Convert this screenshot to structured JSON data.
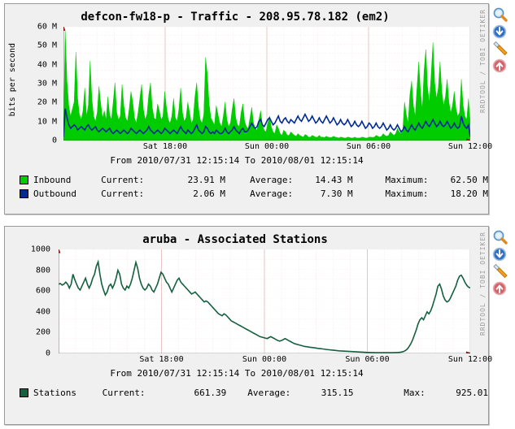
{
  "charts": [
    {
      "title": "defcon-fw18-p - Traffic - 208.95.78.182 (em2)",
      "ylabel": "bits per second",
      "watermark": "RRDTOOL / TOBI OETIKER",
      "range": "From 2010/07/31 12:15:14 To 2010/08/01 12:15:14",
      "yticks": [
        "60 M",
        "50 M",
        "40 M",
        "30 M",
        "20 M",
        "10 M",
        "0"
      ],
      "xticks": [
        "Sat 18:00",
        "Sun 00:00",
        "Sun 06:00",
        "Sun 12:00"
      ],
      "legend": [
        {
          "color": "#00cc00",
          "name": "Inbound",
          "k1": "Current:",
          "v1": "23.91 M",
          "k2": "Average:",
          "v2": "14.43 M",
          "k3": "Maximum:",
          "v3": "62.50 M"
        },
        {
          "color": "#002a97",
          "name": "Outbound",
          "k1": "Current:",
          "v1": "2.06 M",
          "k2": "Average:",
          "v2": "7.30 M",
          "k3": "Maximum:",
          "v3": "18.20 M"
        }
      ]
    },
    {
      "title": "aruba - Associated Stations",
      "ylabel": "",
      "watermark": "RRDTOOL / TOBI OETIKER",
      "range": "From 2010/07/31 12:15:14 To 2010/08/01 12:15:14",
      "yticks": [
        "1000",
        "800",
        "600",
        "400",
        "200",
        "0"
      ],
      "xticks": [
        "Sat 18:00",
        "Sun 00:00",
        "Sun 06:00",
        "Sun 12:00"
      ],
      "legend": [
        {
          "color": "#14603f",
          "name": "Stations",
          "k1": "Current:",
          "v1": "661.39",
          "k2": "Average:",
          "v2": "315.15",
          "k3": "Max:",
          "v3": "925.01"
        }
      ]
    }
  ],
  "icons": [
    {
      "name": "zoom-in-icon",
      "title": "Zoom"
    },
    {
      "name": "zoom-out-icon",
      "title": "Shrink"
    },
    {
      "name": "settings-wrench-icon",
      "title": "Properties"
    },
    {
      "name": "refresh-up-icon",
      "title": "Grow"
    }
  ],
  "chart_data": [
    {
      "type": "area",
      "title": "defcon-fw18-p - Traffic - 208.95.78.182 (em2)",
      "xlabel": "From 2010/07/31 12:15:14 To 2010/08/01 12:15:14",
      "ylabel": "bits per second",
      "ylim": [
        0,
        65000000
      ],
      "yticks": [
        0,
        10000000,
        20000000,
        30000000,
        40000000,
        50000000,
        60000000
      ],
      "ytick_labels": [
        "0",
        "10 M",
        "20 M",
        "30 M",
        "40 M",
        "50 M",
        "60 M"
      ],
      "xtick_labels": [
        "Sat 18:00",
        "Sun 00:00",
        "Sun 06:00",
        "Sun 12:00"
      ],
      "xtick_fracs": [
        0.25,
        0.5,
        0.75,
        1.0
      ],
      "grid": true,
      "legend_position": "below",
      "series": [
        {
          "name": "Inbound",
          "color": "#00cc00",
          "style": "filled-area",
          "current": 23910000,
          "average": 14430000,
          "maximum": 62500000,
          "unit": "bits per second",
          "values": [
            4.0,
            62.5,
            34.0,
            20.0,
            14.0,
            18.0,
            22.0,
            50.5,
            24.0,
            15.0,
            12.0,
            17.0,
            30.0,
            14.0,
            20.0,
            45.5,
            24.0,
            14.0,
            11.0,
            16.0,
            31.0,
            21.0,
            13.0,
            17.0,
            12.0,
            25.0,
            15.0,
            12.0,
            22.0,
            33.0,
            16.0,
            12.0,
            14.0,
            32.0,
            20.0,
            13.0,
            11.0,
            18.0,
            28.0,
            22.0,
            13.0,
            10.0,
            16.0,
            24.0,
            32.0,
            18.0,
            12.0,
            15.0,
            26.0,
            33.0,
            19.0,
            13.0,
            12.0,
            21.0,
            17.0,
            12.0,
            14.0,
            28.0,
            19.0,
            12.0,
            10.0,
            14.0,
            24.0,
            13.0,
            11.0,
            18.0,
            30.0,
            16.0,
            11.0,
            13.0,
            22.0,
            16.0,
            10.0,
            12.0,
            25.0,
            33.0,
            19.0,
            12.0,
            10.0,
            15.0,
            47.5,
            38.0,
            21.0,
            13.0,
            11.0,
            9.0,
            20.0,
            15.0,
            10.0,
            8.0,
            14.0,
            22.0,
            12.0,
            8.0,
            10.0,
            18.0,
            24.0,
            13.0,
            9.0,
            8.0,
            16.0,
            21.0,
            11.0,
            8.0,
            7.0,
            13.0,
            19.0,
            10.0,
            7.0,
            6.0,
            12.0,
            17.0,
            9.0,
            6.0,
            5.0,
            10.0,
            14.0,
            8.0,
            5.0,
            4.0,
            9.0,
            7.0,
            4.0,
            3.0,
            6.0,
            5.0,
            3.0,
            3.0,
            5.0,
            4.0,
            3.0,
            2.5,
            4.0,
            3.0,
            2.5,
            2.0,
            3.5,
            3.0,
            2.0,
            2.0,
            3.0,
            2.5,
            2.0,
            2.0,
            3.0,
            2.0,
            2.0,
            1.8,
            2.5,
            2.0,
            1.8,
            1.8,
            2.5,
            2.0,
            1.8,
            1.5,
            2.0,
            1.8,
            1.5,
            1.5,
            2.0,
            1.8,
            1.5,
            1.5,
            2.0,
            1.5,
            1.5,
            1.5,
            2.0,
            1.8,
            1.5,
            1.5,
            2.0,
            2.0,
            1.8,
            2.0,
            3.0,
            2.5,
            2.0,
            2.5,
            4.0,
            3.0,
            2.5,
            3.0,
            5.0,
            4.0,
            3.0,
            4.0,
            7.0,
            5.0,
            4.0,
            6.0,
            22.0,
            15.0,
            10.0,
            26.0,
            34.0,
            20.0,
            14.0,
            30.0,
            45.0,
            28.0,
            18.0,
            40.0,
            52.0,
            30.0,
            22.0,
            38.0,
            56.0,
            33.0,
            24.0,
            30.0,
            45.0,
            28.0,
            20.0,
            25.0,
            35.0,
            22.0,
            16.0,
            20.0,
            28.0,
            18.0,
            14.0,
            16.0,
            35.0,
            20.0,
            14.0,
            12.0,
            24.0,
            10.0
          ]
        },
        {
          "name": "Outbound",
          "color": "#002a97",
          "style": "line",
          "current": 2060000,
          "average": 7300000,
          "maximum": 18200000,
          "unit": "bits per second",
          "values": [
            2.0,
            18.2,
            13.0,
            9.0,
            7.0,
            8.0,
            9.0,
            8.0,
            6.0,
            7.0,
            8.0,
            7.0,
            6.0,
            8.0,
            9.0,
            7.0,
            6.0,
            7.0,
            8.0,
            6.0,
            5.0,
            6.0,
            7.0,
            6.0,
            5.0,
            6.0,
            7.0,
            5.0,
            4.0,
            5.0,
            6.0,
            5.0,
            4.0,
            5.0,
            6.0,
            5.0,
            4.0,
            5.0,
            7.0,
            6.0,
            5.0,
            4.0,
            5.0,
            6.0,
            5.0,
            4.0,
            5.0,
            6.0,
            8.0,
            6.0,
            5.0,
            4.0,
            5.0,
            6.0,
            5.0,
            4.0,
            5.0,
            7.0,
            6.0,
            5.0,
            4.0,
            5.0,
            6.0,
            5.0,
            4.0,
            6.0,
            8.0,
            6.0,
            5.0,
            4.0,
            6.0,
            5.0,
            4.0,
            5.0,
            7.0,
            9.0,
            6.0,
            5.0,
            4.0,
            5.0,
            8.0,
            7.0,
            5.0,
            4.0,
            5.0,
            4.0,
            6.0,
            5.0,
            4.0,
            4.0,
            5.0,
            7.0,
            5.0,
            4.0,
            5.0,
            6.0,
            8.0,
            6.0,
            5.0,
            4.0,
            6.0,
            7.0,
            5.0,
            5.0,
            6.0,
            8.0,
            10.0,
            8.0,
            7.0,
            8.0,
            11.0,
            12.0,
            9.0,
            8.0,
            10.0,
            12.0,
            13.0,
            11.0,
            9.0,
            10.0,
            12.0,
            14.0,
            11.0,
            10.0,
            12.0,
            13.0,
            11.0,
            10.0,
            12.0,
            11.0,
            10.0,
            12.0,
            14.0,
            12.0,
            11.0,
            13.0,
            15.0,
            13.0,
            11.0,
            12.0,
            14.0,
            12.0,
            10.0,
            11.0,
            13.0,
            11.0,
            10.0,
            12.0,
            14.0,
            12.0,
            10.0,
            11.0,
            13.0,
            11.0,
            9.0,
            10.0,
            12.0,
            10.0,
            9.0,
            10.0,
            12.0,
            10.0,
            8.0,
            9.0,
            11.0,
            9.0,
            8.0,
            9.0,
            11.0,
            9.0,
            7.0,
            8.0,
            10.0,
            9.0,
            7.0,
            8.0,
            10.0,
            8.0,
            7.0,
            8.0,
            10.0,
            8.0,
            6.0,
            7.0,
            9.0,
            7.0,
            6.0,
            7.0,
            9.0,
            7.0,
            5.0,
            6.0,
            8.0,
            6.0,
            5.0,
            7.0,
            9.0,
            7.0,
            6.0,
            8.0,
            10.0,
            8.0,
            7.0,
            9.0,
            11.0,
            9.0,
            8.0,
            10.0,
            12.0,
            10.0,
            8.0,
            9.0,
            11.0,
            9.0,
            8.0,
            9.0,
            11.0,
            9.0,
            7.0,
            8.0,
            10.0,
            8.0,
            7.0,
            8.0,
            14.0,
            10.0,
            8.0,
            7.0,
            9.0,
            2.0
          ]
        }
      ]
    },
    {
      "type": "line",
      "title": "aruba - Associated Stations",
      "xlabel": "From 2010/07/31 12:15:14 To 2010/08/01 12:15:14",
      "ylabel": "",
      "ylim": [
        0,
        1050
      ],
      "yticks": [
        0,
        200,
        400,
        600,
        800,
        1000
      ],
      "ytick_labels": [
        "0",
        "200",
        "400",
        "600",
        "800",
        "1000"
      ],
      "xtick_labels": [
        "Sat 18:00",
        "Sun 00:00",
        "Sun 06:00",
        "Sun 12:00"
      ],
      "xtick_fracs": [
        0.25,
        0.5,
        0.75,
        1.0
      ],
      "grid": true,
      "legend_position": "below",
      "series": [
        {
          "name": "Stations",
          "color": "#14603f",
          "style": "line",
          "current": 661.39,
          "average": 315.15,
          "maximum": 925.01,
          "values": [
            700,
            705,
            690,
            700,
            720,
            700,
            660,
            700,
            800,
            745,
            700,
            660,
            640,
            680,
            720,
            760,
            700,
            660,
            700,
            760,
            800,
            880,
            925,
            800,
            700,
            640,
            590,
            620,
            680,
            700,
            660,
            700,
            760,
            840,
            800,
            700,
            660,
            640,
            680,
            660,
            700,
            760,
            840,
            920,
            860,
            760,
            700,
            660,
            640,
            660,
            700,
            680,
            640,
            620,
            660,
            700,
            760,
            820,
            800,
            760,
            720,
            700,
            660,
            620,
            660,
            700,
            740,
            760,
            720,
            700,
            680,
            660,
            640,
            620,
            600,
            610,
            620,
            600,
            580,
            560,
            540,
            520,
            530,
            520,
            500,
            480,
            460,
            440,
            420,
            400,
            390,
            380,
            400,
            390,
            370,
            350,
            330,
            320,
            310,
            300,
            290,
            280,
            270,
            260,
            250,
            240,
            230,
            220,
            210,
            200,
            190,
            180,
            170,
            165,
            160,
            155,
            150,
            160,
            170,
            160,
            150,
            140,
            130,
            125,
            130,
            140,
            150,
            140,
            130,
            120,
            110,
            100,
            95,
            90,
            85,
            80,
            75,
            70,
            68,
            65,
            62,
            60,
            58,
            55,
            52,
            50,
            48,
            45,
            43,
            40,
            38,
            36,
            34,
            32,
            30,
            28,
            26,
            25,
            24,
            23,
            22,
            21,
            20,
            19,
            18,
            17,
            16,
            15,
            14,
            13,
            12,
            11,
            10,
            10,
            9,
            9,
            8,
            8,
            8,
            8,
            8,
            8,
            8,
            8,
            8,
            8,
            8,
            9,
            9,
            10,
            12,
            15,
            20,
            30,
            45,
            70,
            100,
            140,
            190,
            240,
            300,
            340,
            360,
            340,
            380,
            420,
            400,
            430,
            480,
            540,
            600,
            680,
            700,
            650,
            580,
            540,
            520,
            530,
            560,
            600,
            640,
            680,
            740,
            780,
            790,
            760,
            720,
            690,
            670,
            661
          ]
        }
      ]
    }
  ]
}
